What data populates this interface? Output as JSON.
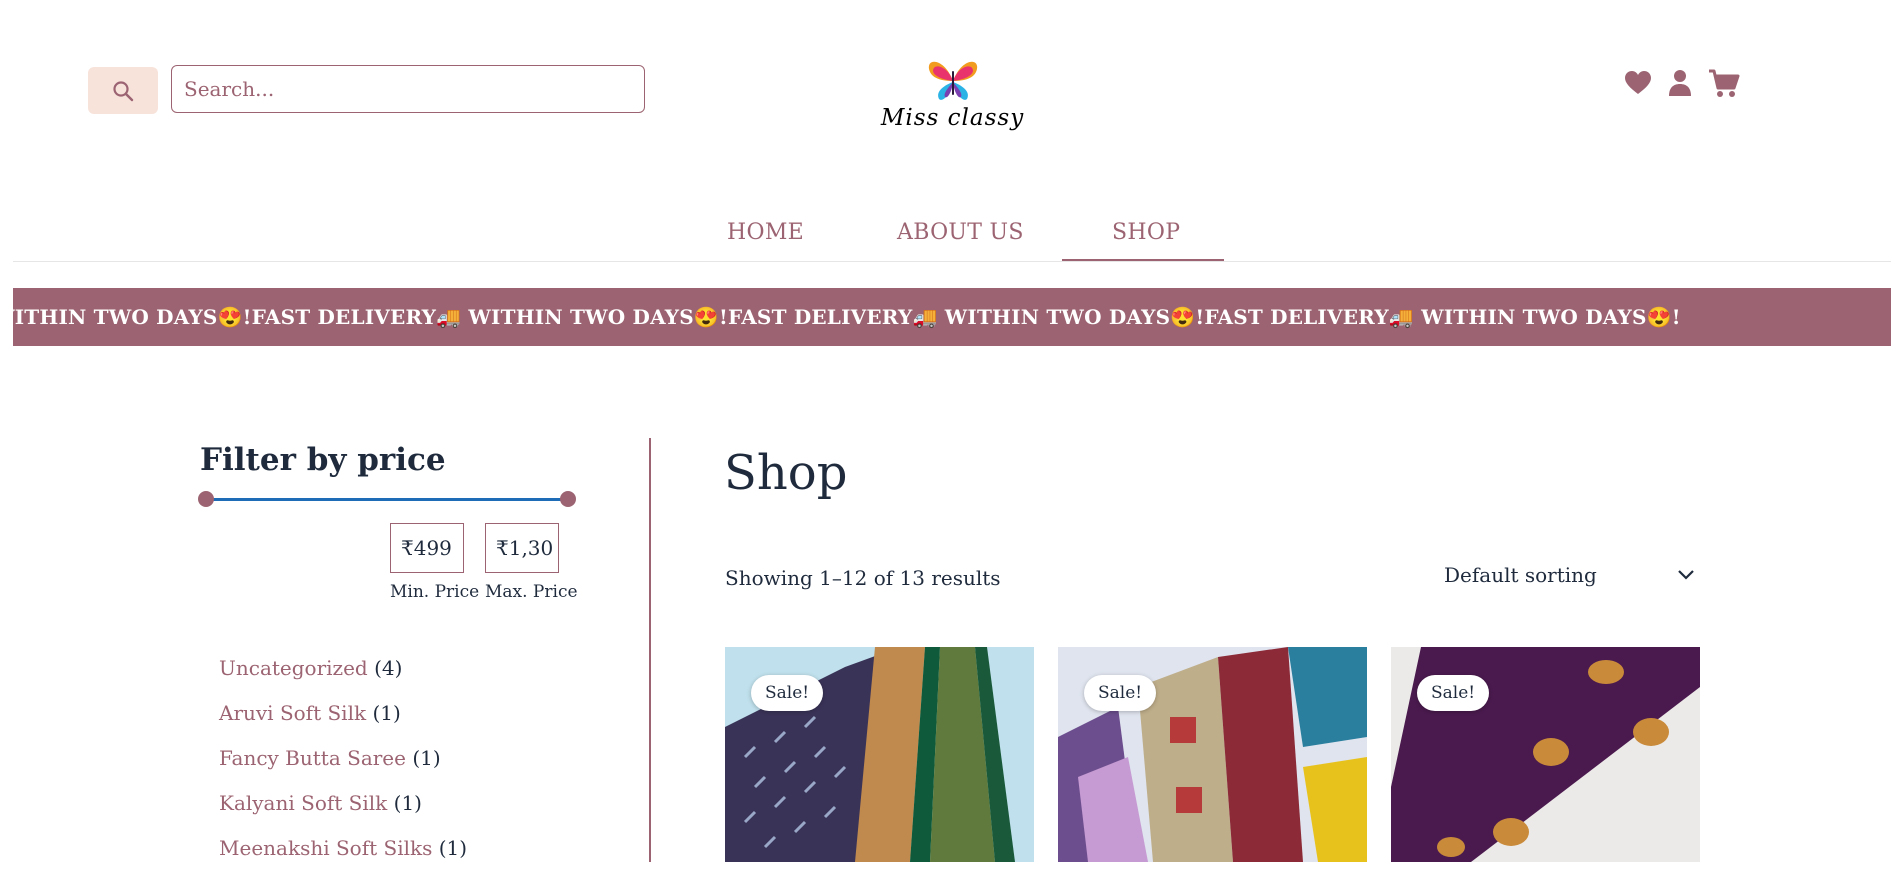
{
  "header": {
    "search": {
      "placeholder": "Search...",
      "value": ""
    },
    "logo_text": "Miss classy",
    "icons": [
      "heart-icon",
      "user-icon",
      "cart-icon"
    ]
  },
  "nav": {
    "items": [
      {
        "label": "HOME",
        "active": false
      },
      {
        "label": "ABOUT US",
        "active": false
      },
      {
        "label": "SHOP",
        "active": true
      }
    ]
  },
  "announcement": {
    "text": "VITHIN TWO DAYS😍!FAST DELIVERY🚚 WITHIN TWO DAYS😍!FAST DELIVERY🚚 WITHIN TWO DAYS😍!FAST DELIVERY🚚 WITHIN TWO DAYS😍!"
  },
  "sidebar": {
    "filter_title": "Filter by price",
    "min_price": "₹499",
    "max_price": "₹1,30",
    "min_label": "Min. Price",
    "max_label": "Max. Price",
    "categories": [
      {
        "name": "Uncategorized",
        "count": "(4)"
      },
      {
        "name": "Aruvi Soft Silk",
        "count": "(1)"
      },
      {
        "name": "Fancy Butta Saree",
        "count": "(1)"
      },
      {
        "name": "Kalyani Soft Silk",
        "count": "(1)"
      },
      {
        "name": "Meenakshi Soft Silks",
        "count": "(1)"
      }
    ]
  },
  "main": {
    "title": "Shop",
    "result_count": "Showing 1–12 of 13 results",
    "sorting": "Default sorting",
    "products": [
      {
        "badge": "Sale!"
      },
      {
        "badge": "Sale!"
      },
      {
        "badge": "Sale!"
      }
    ]
  },
  "colors": {
    "accent": "#9c6472",
    "text": "#1f2b3d",
    "search_button_bg": "#f8e3db",
    "slider": "#1e6bb8"
  }
}
